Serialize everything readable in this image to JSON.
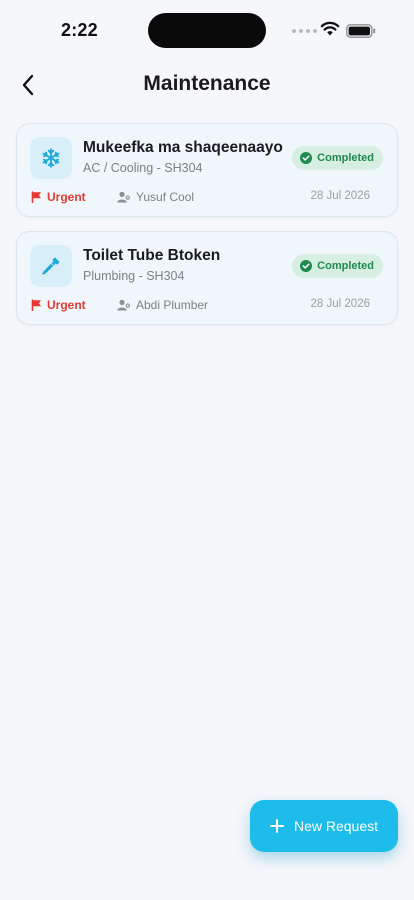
{
  "status_bar": {
    "time": "2:22"
  },
  "header": {
    "title": "Maintenance",
    "back_icon": "chevron-left-icon"
  },
  "requests": [
    {
      "title": "Mukeefka ma shaqeenaayo",
      "subtitle": "AC / Cooling - SH304",
      "category_icon": "snowflake-icon",
      "status": "Completed",
      "priority": "Urgent",
      "assignee": "Yusuf Cool",
      "date": "28 Jul 2026"
    },
    {
      "title": "Toilet Tube Btoken",
      "subtitle": "Plumbing - SH304",
      "category_icon": "wrench-icon",
      "status": "Completed",
      "priority": "Urgent",
      "assignee": "Abdi Plumber",
      "date": "28 Jul 2026"
    }
  ],
  "fab": {
    "label": "New Request",
    "icon": "plus-icon"
  },
  "colors": {
    "accent": "#1DBCEB",
    "status_completed_bg": "#D7EFE3",
    "status_completed_text": "#1F8A4C",
    "priority_urgent": "#E53935",
    "background": "#F5F7FA"
  }
}
